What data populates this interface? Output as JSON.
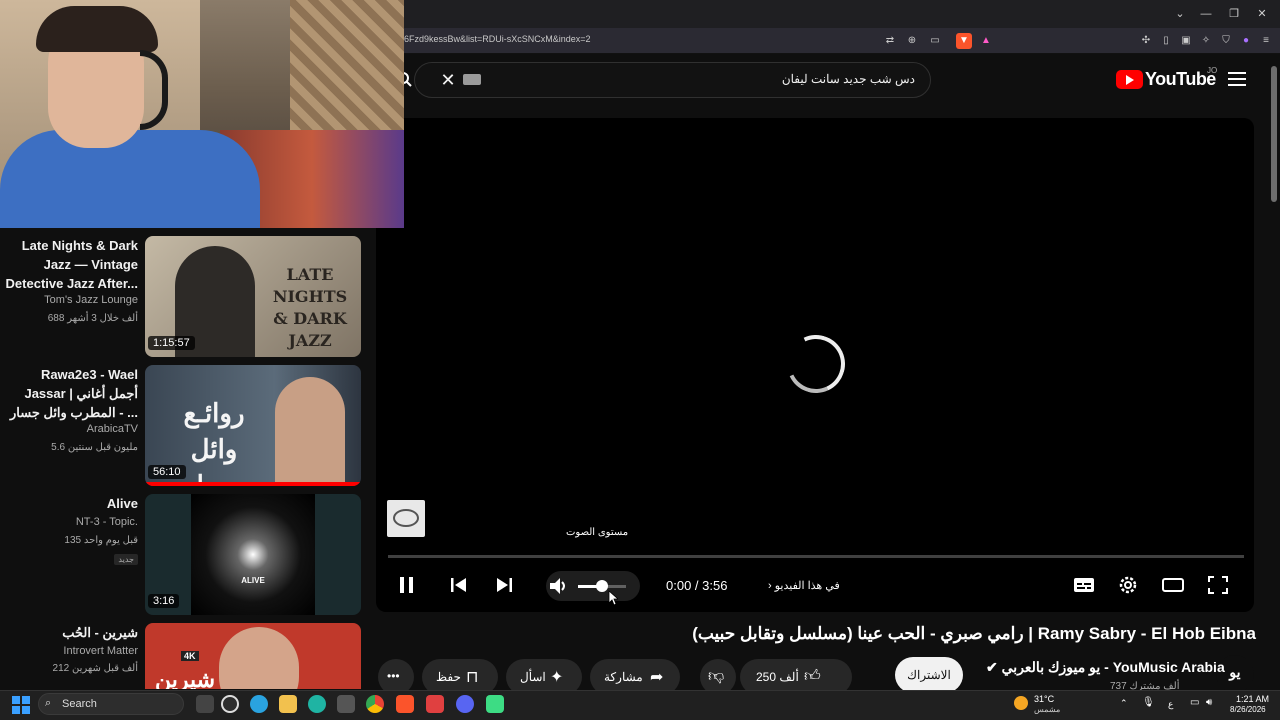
{
  "browser": {
    "url": "6Fzd9kessBw&list=RDUi-sXcSNCxM&index=2",
    "window_controls": [
      "⌄",
      "—",
      "❐",
      "✕"
    ]
  },
  "youtube": {
    "logo_text": "YouTube",
    "logo_region": "JO",
    "search_query": "دس شب جديد سانت ليفان"
  },
  "player": {
    "volume_tooltip": "مستوى الصوت",
    "time_current": "0:00",
    "time_separator": " / ",
    "time_total": "3:56",
    "chapter_label": "في هذا الفيديو",
    "volume_level": 0.5,
    "progress": 0
  },
  "video": {
    "title": "رامي صبري - الحب عينا (مسلسل وتقابل حبيب) | Ramy Sabry - El Hob Eibna",
    "channel_name": "يو ميوزك بالعربي - YouMusic Arabia",
    "channel_subs": "737 ألف مشترك",
    "subscribe_label": "الاشتراك",
    "avatar_text": "يو",
    "like_count": "250 ألف",
    "share_label": "مشاركة",
    "ask_label": "اسأل",
    "save_label": "حفظ",
    "more_label": "•••"
  },
  "recommendations": [
    {
      "title": "Late Nights & Dark Jazz — Vintage Detective Jazz After...",
      "channel": "Tom's Jazz Lounge",
      "views": "688 ألف  خلال 3 أشهر",
      "duration": "1:15:57",
      "thumb_text": "LATE NIGHTS & DARK JAZZ"
    },
    {
      "title": "Rawa2e3 - Wael Jassar | أجمل أغاني المطرب وائل جسار - ...",
      "channel": "ArabicaTV",
      "views": "5.6 مليون  قبل سنتين",
      "duration": "56:10",
      "thumb_text": "روائـع وائل جسار"
    },
    {
      "title": "Alive",
      "channel": "NT-3 - Topic.",
      "views": "135  قبل يوم واحد",
      "badge": "جديد",
      "duration": "3:16",
      "thumb_text": "ALIVE"
    },
    {
      "title": "شيرين - الحُب",
      "channel": "Introvert Matter",
      "views": "212 ألف  قبل شهرين",
      "duration": "",
      "thumb_text": "شيرين",
      "thumb_badge": "4K"
    }
  ],
  "taskbar": {
    "search_label": "Search",
    "weather_temp": "31°C",
    "weather_desc": "مشمس",
    "lang": "ع",
    "time": "1:21 AM",
    "date": "8/26/2026"
  },
  "colors": {
    "youtube_red": "#ff0000",
    "background": "#0f0f0f",
    "button_bg": "#272727"
  }
}
